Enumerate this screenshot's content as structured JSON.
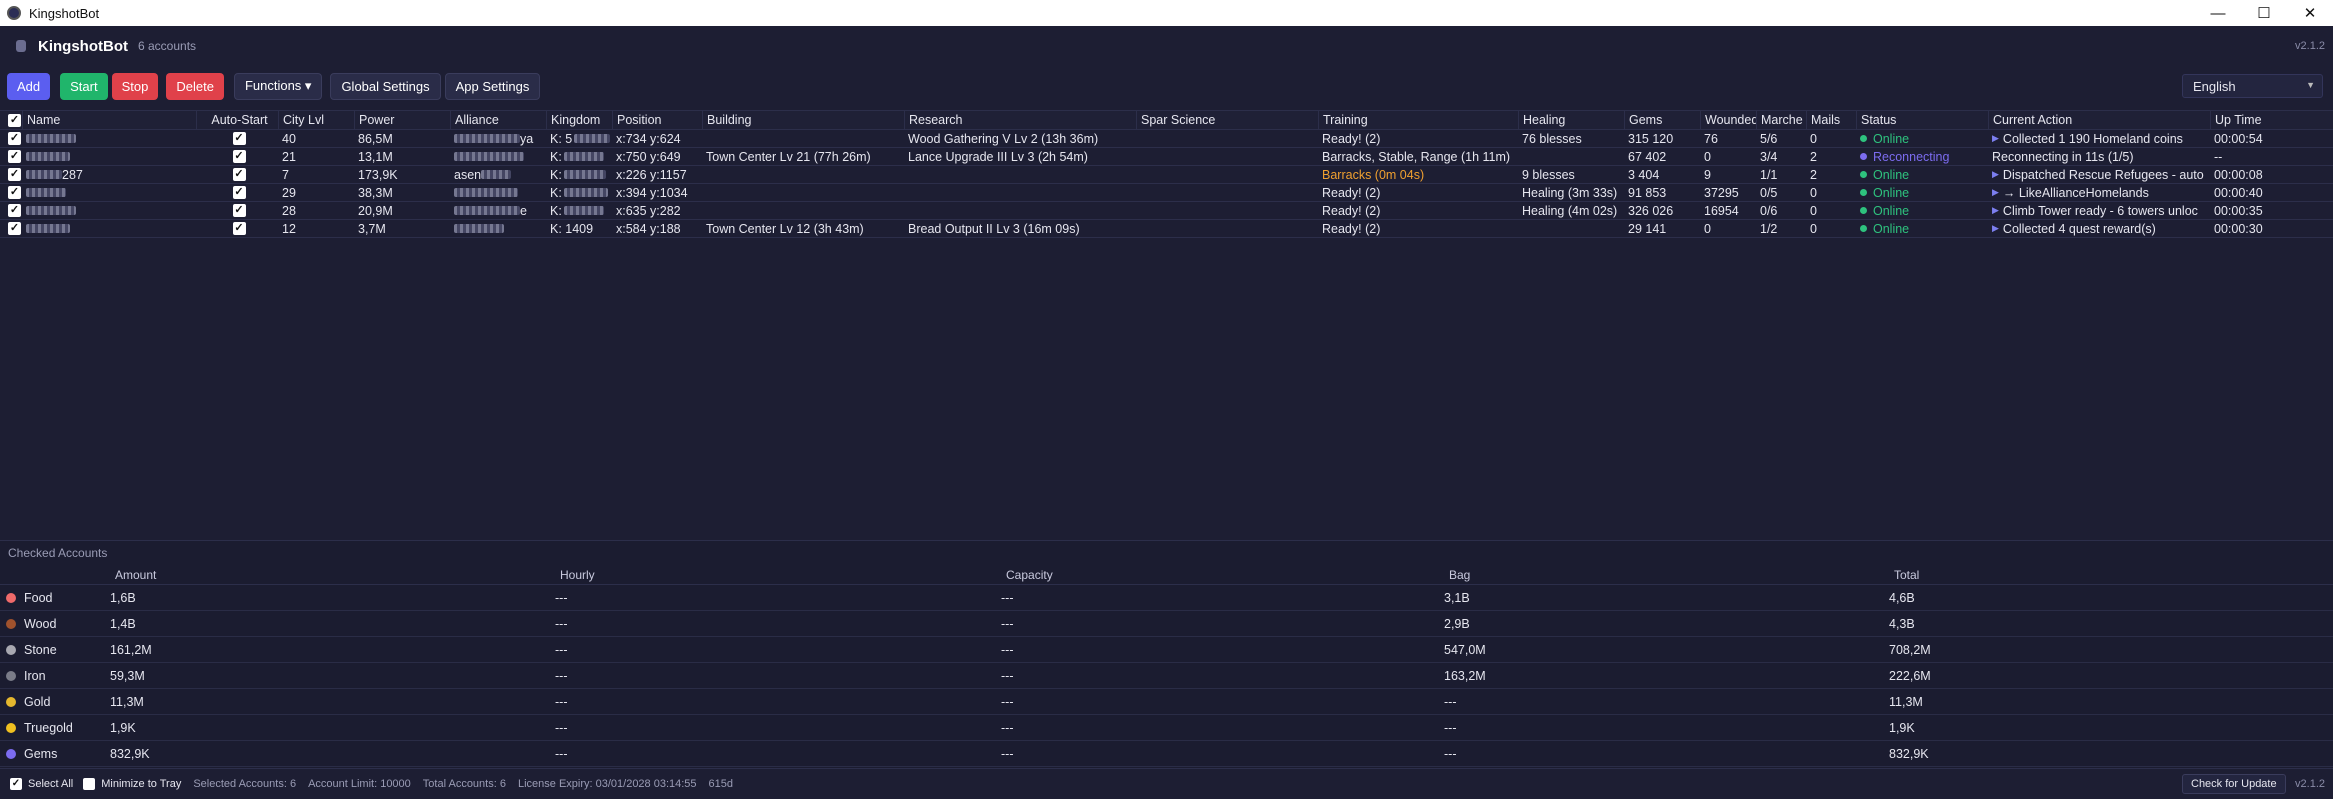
{
  "window": {
    "title": "KingshotBot",
    "minimize": "—",
    "maximize": "☐",
    "close": "✕"
  },
  "header": {
    "app_name": "KingshotBot",
    "accounts_count": "6 accounts",
    "version": "v2.1.2"
  },
  "toolbar": {
    "add": "Add",
    "start": "Start",
    "stop": "Stop",
    "delete": "Delete",
    "functions": "Functions ▾",
    "global_settings": "Global Settings",
    "app_settings": "App Settings",
    "language": "English"
  },
  "table": {
    "columns": [
      "Name",
      "Auto-Start",
      "City Lvl",
      "Power",
      "Alliance",
      "Kingdom",
      "Position",
      "Building",
      "Research",
      "Spar Science",
      "Training",
      "Healing",
      "Gems",
      "Wounded",
      "Marche",
      "Mails",
      "Status",
      "Current Action",
      "Up Time"
    ],
    "rows": [
      {
        "name_tail": "",
        "city": "40",
        "power": "86,5M",
        "alliance_tail": "ya",
        "kingdom": "K: 5",
        "position": "x:734 y:624",
        "building": "",
        "research": "Wood Gathering V Lv 2 (13h 36m)",
        "spar": "",
        "training": "Ready! (2)",
        "training_color": "#e6e6ef",
        "healing": "76 blesses",
        "gems": "315 120",
        "wounded": "76",
        "marche": "5/6",
        "mails": "0",
        "status": "Online",
        "status_color": "#2ec27e",
        "action": "Collected 1 190 Homeland coins",
        "uptime": "00:00:54"
      },
      {
        "name_tail": "",
        "city": "21",
        "power": "13,1M",
        "alliance_tail": "",
        "kingdom": "K:",
        "position": "x:750 y:649",
        "building": "Town Center Lv 21 (77h 26m)",
        "research": "Lance Upgrade III Lv 3 (2h 54m)",
        "spar": "",
        "training": "Barracks, Stable, Range (1h 11m)",
        "training_color": "#e6e6ef",
        "healing": "",
        "gems": "67 402",
        "wounded": "0",
        "marche": "3/4",
        "mails": "2",
        "status": "Reconnecting",
        "status_color": "#7c6cf0",
        "action": "Reconnecting in 11s (1/5)",
        "uptime": "--"
      },
      {
        "name_tail": "287",
        "city": "7",
        "power": "173,9K",
        "alliance_tail": "asen",
        "kingdom": "K:",
        "position": "x:226 y:1157",
        "building": "",
        "research": "",
        "spar": "",
        "training": "Barracks (0m 04s)",
        "training_color": "#f0a030",
        "healing": "9 blesses",
        "gems": "3 404",
        "wounded": "9",
        "marche": "1/1",
        "mails": "2",
        "status": "Online",
        "status_color": "#2ec27e",
        "action": "Dispatched Rescue Refugees - auto",
        "uptime": "00:00:08"
      },
      {
        "name_tail": "",
        "city": "29",
        "power": "38,3M",
        "alliance_tail": "",
        "kingdom": "K:",
        "position": "x:394 y:1034",
        "building": "",
        "research": "",
        "spar": "",
        "training": "Ready! (2)",
        "training_color": "#e6e6ef",
        "healing": "Healing (3m 33s)",
        "gems": "91 853",
        "wounded": "37295",
        "marche": "0/5",
        "mails": "0",
        "status": "Online",
        "status_color": "#2ec27e",
        "action": "→ LikeAllianceHomelands",
        "uptime": "00:00:40"
      },
      {
        "name_tail": "",
        "city": "28",
        "power": "20,9M",
        "alliance_tail": "e",
        "kingdom": "K:",
        "position": "x:635 y:282",
        "building": "",
        "research": "",
        "spar": "",
        "training": "Ready! (2)",
        "training_color": "#e6e6ef",
        "healing": "Healing (4m 02s)",
        "gems": "326 026",
        "wounded": "16954",
        "marche": "0/6",
        "mails": "0",
        "status": "Online",
        "status_color": "#2ec27e",
        "action": "Climb Tower ready - 6 towers unloc",
        "uptime": "00:00:35"
      },
      {
        "name_tail": "",
        "city": "12",
        "power": "3,7M",
        "alliance_tail": "",
        "kingdom": "K: 1409",
        "position": "x:584 y:188",
        "building": "Town Center Lv 12 (3h 43m)",
        "research": "Bread Output II Lv 3 (16m 09s)",
        "spar": "",
        "training": "Ready! (2)",
        "training_color": "#e6e6ef",
        "healing": "",
        "gems": "29 141",
        "wounded": "0",
        "marche": "1/2",
        "mails": "0",
        "status": "Online",
        "status_color": "#2ec27e",
        "action": "Collected 4 quest reward(s)",
        "uptime": "00:00:30"
      }
    ]
  },
  "resources": {
    "title": "Checked Accounts",
    "columns": [
      "Amount",
      "Hourly",
      "Capacity",
      "Bag",
      "Total"
    ],
    "rows": [
      {
        "name": "Food",
        "color": "#f06a6a",
        "amount": "1,6B",
        "hourly": "---",
        "capacity": "---",
        "bag": "3,1B",
        "total": "4,6B"
      },
      {
        "name": "Wood",
        "color": "#a0522d",
        "amount": "1,4B",
        "hourly": "---",
        "capacity": "---",
        "bag": "2,9B",
        "total": "4,3B"
      },
      {
        "name": "Stone",
        "color": "#a8a8b0",
        "amount": "161,2M",
        "hourly": "---",
        "capacity": "---",
        "bag": "547,0M",
        "total": "708,2M"
      },
      {
        "name": "Iron",
        "color": "#7a7c88",
        "amount": "59,3M",
        "hourly": "---",
        "capacity": "---",
        "bag": "163,2M",
        "total": "222,6M"
      },
      {
        "name": "Gold",
        "color": "#e6b82e",
        "amount": "11,3M",
        "hourly": "---",
        "capacity": "---",
        "bag": "---",
        "total": "11,3M"
      },
      {
        "name": "Truegold",
        "color": "#f0c020",
        "amount": "1,9K",
        "hourly": "---",
        "capacity": "---",
        "bag": "---",
        "total": "1,9K"
      },
      {
        "name": "Gems",
        "color": "#7c6cf0",
        "amount": "832,9K",
        "hourly": "---",
        "capacity": "---",
        "bag": "---",
        "total": "832,9K"
      }
    ]
  },
  "footer": {
    "select_all": "Select All",
    "minimize_tray": "Minimize to Tray",
    "selected": "Selected Accounts: 6",
    "limit": "Account Limit: 10000",
    "total": "Total Accounts: 6",
    "license": "License Expiry: 03/01/2028 03:14:55",
    "days": "615d",
    "update": "Check for Update",
    "version": "v2.1.2"
  }
}
